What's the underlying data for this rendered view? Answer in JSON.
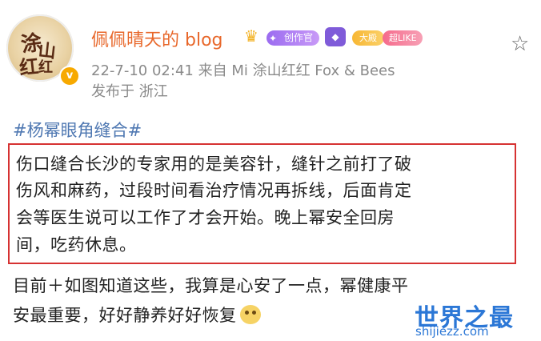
{
  "post": {
    "avatar": {
      "glyphs": [
        "涂",
        "山",
        "红",
        "红"
      ],
      "verified": "v"
    },
    "username": "佩佩晴天的 blog",
    "badges": [
      "创作官",
      "",
      "大殿",
      "超LIKE"
    ],
    "timestamp": "22-7-10 02:41",
    "source": "来自 Mi 涂山红红 Fox & Bees",
    "location": "发布于 浙江",
    "hashtag": "#杨幂眼角缝合#",
    "quoted_lines": [
      "伤口缝合长沙的专家用的是美容针，缝针之前打了破",
      "伤风和麻药，过段时间看治疗情况再拆线，后面肯定",
      "会等医生说可以工作了才会开始。晚上幂安全回房",
      "间，吃药休息。"
    ],
    "body_lines": [
      "目前＋如图知道这些，我算是心安了一点，幂健康平",
      "安最重要，好好静养好好恢复"
    ],
    "watermark": {
      "title": "世界之最",
      "url": "shijiezz.com"
    }
  },
  "icons": [
    "crown-icon",
    "star-icon",
    "emoji-icon",
    "verified-icon"
  ],
  "colors": {
    "username": "#e8672a",
    "hashtag": "#4f78b2",
    "highlight_box": "#d63232",
    "watermark": "#2b77d6"
  }
}
